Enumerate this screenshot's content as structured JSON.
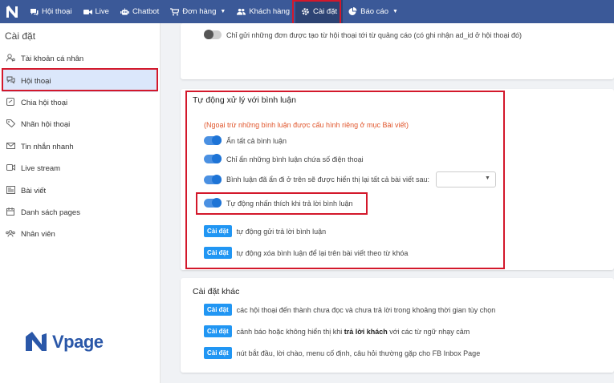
{
  "nav": {
    "items": [
      {
        "label": "Hội thoại",
        "icon": "chat-icon"
      },
      {
        "label": "Live",
        "icon": "video-icon"
      },
      {
        "label": "Chatbot",
        "icon": "robot-icon"
      },
      {
        "label": "Đơn hàng",
        "icon": "cart-icon"
      },
      {
        "label": "Khách hàng",
        "icon": "users-icon"
      },
      {
        "label": "Cài đặt",
        "icon": "gear-icon"
      },
      {
        "label": "Báo cáo",
        "icon": "pie-chart-icon"
      }
    ]
  },
  "sidebar": {
    "title": "Cài đặt",
    "items": [
      {
        "label": "Tài khoản cá nhân",
        "icon": "user-settings-icon"
      },
      {
        "label": "Hội thoại",
        "icon": "chat-icon"
      },
      {
        "label": "Chia hội thoại",
        "icon": "split-icon"
      },
      {
        "label": "Nhãn hội thoại",
        "icon": "tag-icon"
      },
      {
        "label": "Tin nhắn nhanh",
        "icon": "envelope-icon"
      },
      {
        "label": "Live stream",
        "icon": "video-icon"
      },
      {
        "label": "Bài viết",
        "icon": "article-icon"
      },
      {
        "label": "Danh sách pages",
        "icon": "calendar-icon"
      },
      {
        "label": "Nhân viên",
        "icon": "staff-icon"
      }
    ]
  },
  "brand": {
    "name": "Vpage"
  },
  "top_card": {
    "ad_row": "Chỉ gửi những đơn được tạo từ hội thoại tới từ quảng cáo (có ghi nhận ad_id ở hội thoại đó)"
  },
  "auto_comment": {
    "title": "Tự động xử lý với bình luận",
    "note": "(Ngoại trừ những bình luận được cấu hình riêng ở mục Bài viết)",
    "toggles": [
      "Ẩn tất cả bình luận",
      "Chỉ ẩn những bình luận chứa số điện thoại",
      "Bình luận đã ẩn đi ở trên sẽ được hiển thị lại tất cả bài viết sau:",
      "Tự động nhấn thích khi trả lời bình luận"
    ],
    "button_label": "Cài đặt",
    "actions": [
      "tự động gửi trả lời bình luận",
      "tự động xóa bình luận để lại trên bài viết theo từ khóa"
    ]
  },
  "other_settings": {
    "title": "Cài đặt khác",
    "button_label": "Cài đặt",
    "row1": "các hội thoại đến thành chưa đọc và chưa trả lời trong khoảng thời gian tùy chọn",
    "row2_before": "cảnh báo hoặc không hiển thị khi",
    "row2_bold": "trả lời khách",
    "row2_after": "với các từ ngữ nhạy cảm",
    "row3": "nút bắt đầu, lời chào, menu cố định, câu hỏi thường gặp cho FB Inbox Page"
  },
  "colors": {
    "nav": "#3b5998",
    "accent": "#2196f3",
    "highlight": "#d3182b",
    "note": "#e0552b"
  }
}
